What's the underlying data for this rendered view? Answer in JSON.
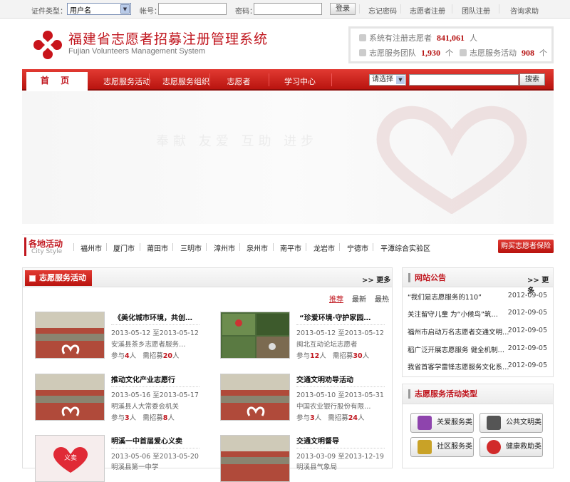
{
  "topbar": {
    "id_type_label": "证件类型：",
    "id_type_value": "用户名",
    "account_label": "帐号：",
    "password_label": "密码：",
    "login": "登录",
    "links": [
      "忘记密码",
      "志愿者注册",
      "团队注册",
      "咨询求助"
    ]
  },
  "header": {
    "title_cn": "福建省志愿者招募注册管理系统",
    "title_en": "Fujian Volunteers Management System"
  },
  "stats": {
    "volunteers_label": "系统有注册志愿者",
    "volunteers": "841,061",
    "volunteers_unit": "人",
    "teams_label": "志愿服务团队",
    "teams": "1,930",
    "teams_unit": "个",
    "activities_label": "志愿服务活动",
    "activities": "908",
    "activities_unit": "个"
  },
  "nav": {
    "home": "首 页",
    "items": [
      "志愿服务活动",
      "志愿服务组织",
      "志愿者",
      "学习中心"
    ],
    "select": "请选择",
    "search": "搜索"
  },
  "banner": {
    "text": "奉献 友爱 互助 进步"
  },
  "cities": {
    "title": "各地活动",
    "subtitle": "City Style",
    "items": [
      "福州市",
      "厦门市",
      "莆田市",
      "三明市",
      "漳州市",
      "泉州市",
      "南平市",
      "龙岩市",
      "宁德市",
      "平潭综合实验区"
    ],
    "insurance": "购买志愿者保险"
  },
  "activities": {
    "title": "志愿服务活动",
    "more": ">> 更多",
    "sort": [
      "推荐",
      "最新",
      "最热"
    ],
    "join_label": "参与",
    "need_label": "需招募",
    "unit": "人",
    "cards": [
      {
        "title": "《美化城市环境，共创…",
        "date": "2013-05-12  至2013-05-12",
        "org": "安溪县茶乡志愿者服务…",
        "join": "4",
        "need": "20"
      },
      {
        "title": "“珍爱环境·守护家园…",
        "date": "2013-05-12  至2013-05-12",
        "org": "闽北互动论坛志愿者",
        "join": "12",
        "need": "30"
      },
      {
        "title": "推动文化产业志愿行",
        "date": "2013-05-16  至2013-05-17",
        "org": "明溪县人大常委会机关",
        "join": "3",
        "need": "8"
      },
      {
        "title": "交通文明劝导活动",
        "date": "2013-05-10  至2013-05-31",
        "org": "中国农业银行股份有限…",
        "join": "3",
        "need": "24"
      },
      {
        "title": "明溪一中首届爱心义卖",
        "date": "2013-05-06  至2013-05-20",
        "org": "明溪县第一中学",
        "join": "",
        "need": ""
      },
      {
        "title": "交通文明督导",
        "date": "2013-03-09  至2013-12-19",
        "org": "明溪县气象局",
        "join": "",
        "need": ""
      }
    ]
  },
  "notices": {
    "title": "网站公告",
    "more": ">> 更多",
    "items": [
      {
        "text": "“我们是志愿服务的110”",
        "date": "2012-09-05"
      },
      {
        "text": "关注留守儿童 为“小候鸟”筑…",
        "date": "2012-09-05"
      },
      {
        "text": "福州市启动万名志愿者交通文明…",
        "date": "2012-09-05"
      },
      {
        "text": "稻广泛开展志愿服务 健全机制…",
        "date": "2012-09-05"
      },
      {
        "text": "我省首客学雷锋志愿服务文化系…",
        "date": "2012-09-05"
      }
    ]
  },
  "types": {
    "title": "志愿服务活动类型",
    "items": [
      "关爱服务类",
      "公共文明类",
      "社区服务类",
      "健康救助类"
    ],
    "colors": [
      "#8e44ad",
      "#555555",
      "#c9a227",
      "#d12a2a"
    ]
  },
  "colors": {
    "brand": "#c0161e",
    "nav_top": "#e23a32",
    "nav_bottom": "#b9140f"
  }
}
